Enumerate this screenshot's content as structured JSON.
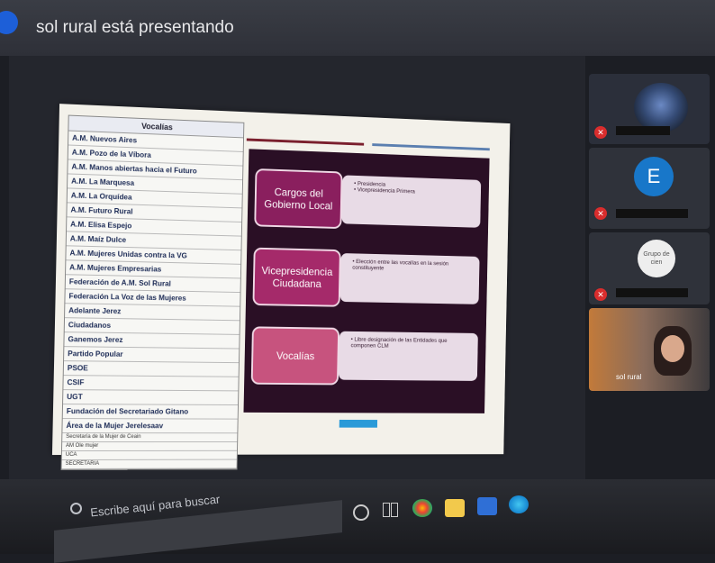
{
  "meeting": {
    "presenter_label": "sol rural está presentando"
  },
  "slide": {
    "table_header": "Vocalías",
    "rows": [
      "A.M. Nuevos Aires",
      "A.M. Pozo de la Víbora",
      "A.M. Manos abiertas hacia el Futuro",
      "A.M. La Marquesa",
      "A.M. La Orquídea",
      "A.M. Futuro Rural",
      "A.M. Elisa Espejo",
      "A.M. Maíz Dulce",
      "A.M. Mujeres Unidas contra la VG",
      "A.M. Mujeres Empresarias",
      "Federación de A.M. Sol Rural",
      "Federación La Voz de las Mujeres",
      "Adelante Jerez",
      "Ciudadanos",
      "Ganemos Jerez",
      "Partido Popular",
      "PSOE",
      "CSIF",
      "UGT",
      "Fundación del Secretariado Gitano",
      "Área de la Mujer Jerelesaav"
    ],
    "small_rows": [
      "Secretaría de la Mujer de Ceain",
      "AM Ole mujer",
      "UCA",
      "SECRETARIA"
    ],
    "boxes": [
      {
        "label": "Cargos del Gobierno Local",
        "bullets": [
          "Presidencia",
          "Vicepresidencia Primera"
        ],
        "color": "#8a1f5e"
      },
      {
        "label": "Vicepresidencia Ciudadana",
        "bullets": [
          "Elección entre las vocalías en la sesión constituyente"
        ],
        "color": "#a52a6a"
      },
      {
        "label": "Vocalías",
        "bullets": [
          "Libre designación de las Entidades que componen CLM"
        ],
        "color": "#c7537e"
      }
    ]
  },
  "participants": [
    {
      "type": "video",
      "mic_muted": true
    },
    {
      "type": "avatar",
      "initial": "E",
      "mic_muted": true
    },
    {
      "type": "image",
      "image_text": "Grupo de cien",
      "mic_muted": true
    },
    {
      "type": "video",
      "name": "sol rural",
      "mic_muted": false
    }
  ],
  "taskbar": {
    "search_placeholder": "Escribe aquí para buscar"
  },
  "colors": {
    "accent_blue": "#1d5fd8",
    "mic_muted": "#d92d2d",
    "slide_panel": "#2a0f25"
  }
}
